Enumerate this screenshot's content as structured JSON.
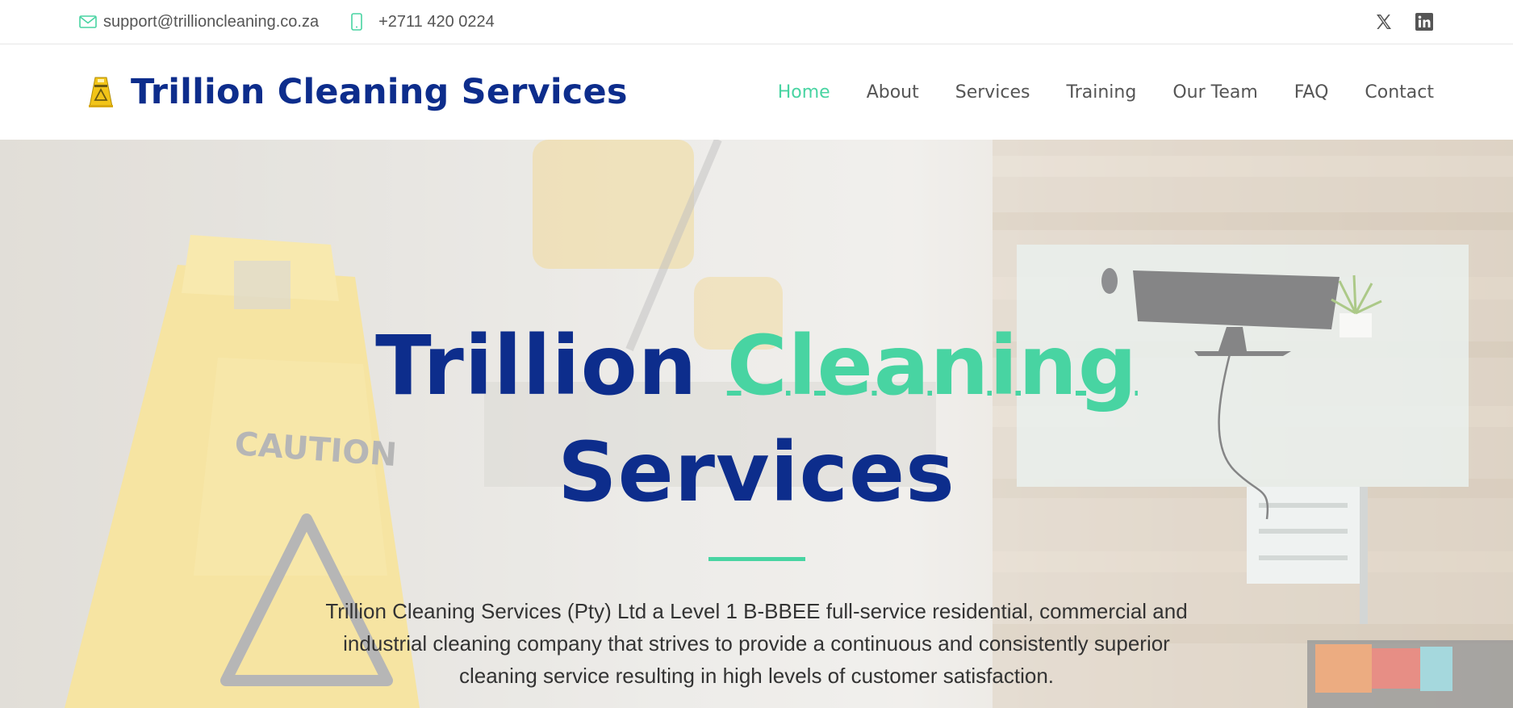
{
  "topbar": {
    "email": "support@trillioncleaning.co.za",
    "phone": "+2711 420 0224",
    "social": [
      {
        "icon": "x-twitter-icon"
      },
      {
        "icon": "linkedin-icon"
      }
    ]
  },
  "header": {
    "brand": "Trillion Cleaning Services",
    "nav": [
      {
        "label": "Home",
        "active": true
      },
      {
        "label": "About"
      },
      {
        "label": "Services"
      },
      {
        "label": "Training"
      },
      {
        "label": "Our Team"
      },
      {
        "label": "FAQ"
      },
      {
        "label": "Contact"
      }
    ]
  },
  "hero": {
    "title_part1": "Trillion",
    "title_accent": "Cleaning",
    "title_part2": "Services",
    "description": "Trillion Cleaning Services (Pty) Ltd a Level 1 B-BBEE full-service residential, commercial and industrial cleaning company that strives to provide a continuous and consistently superior cleaning service resulting in high levels of customer satisfaction.",
    "sign_text": "CAUTION"
  },
  "colors": {
    "brand_blue": "#0d2d8c",
    "accent_green": "#48d4a2"
  }
}
